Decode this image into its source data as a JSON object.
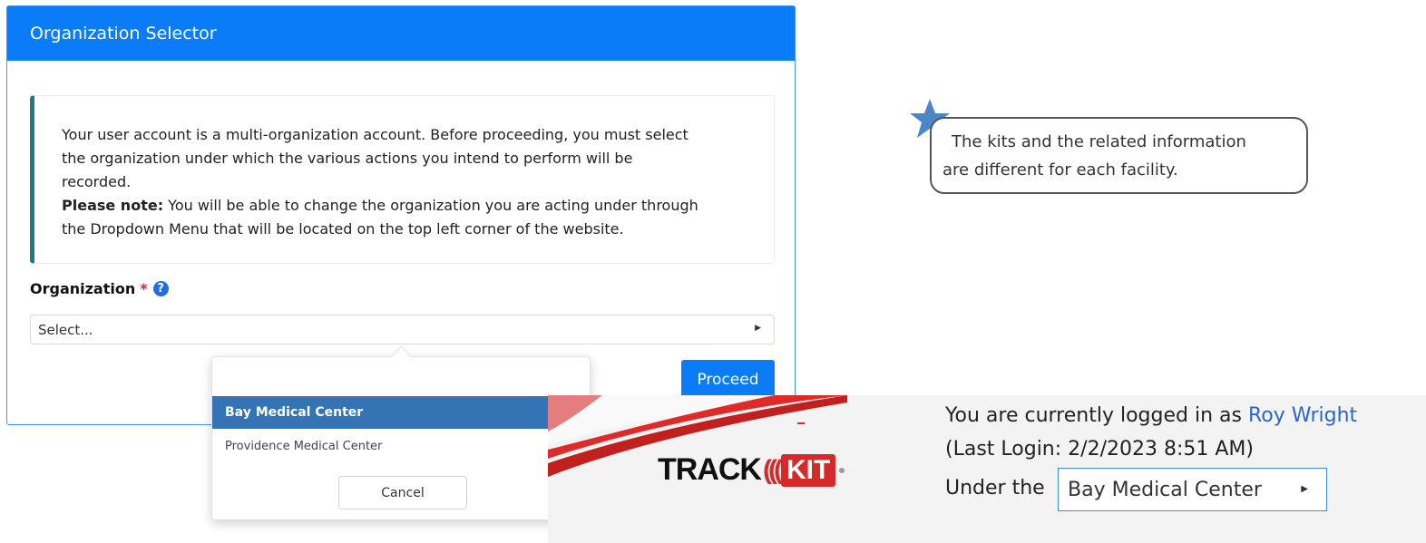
{
  "modal": {
    "title": "Organization Selector",
    "message_line1": "Your user account is a multi-organization account. Before proceeding, you must select",
    "message_line2": "the organization under which the various actions you intend to perform will be",
    "message_line3": "recorded.",
    "note_label": "Please note:",
    "note_line1_rest": " You will be able to change the organization you are acting under through",
    "note_line2": "the Dropdown Menu that will be located on the top left corner of the website.",
    "org_label": "Organization",
    "required_mark": "*",
    "help_icon_glyph": "?",
    "select_placeholder": "Select...",
    "proceed_label": "Proceed"
  },
  "dropdown": {
    "options": [
      "Bay Medical Center",
      "Providence Medical Center"
    ],
    "selected_index": 0,
    "cancel_label": "Cancel"
  },
  "note_bubble": {
    "line1": "The kits and the related information",
    "line2": "are different for each facility.",
    "icon": "star-icon",
    "icon_color": "#4a86c8"
  },
  "banner": {
    "logo_track": "TRACK",
    "logo_waves": "(((",
    "logo_kit": "KIT",
    "login_prefix": "You are currently logged in as ",
    "user_name": "Roy Wright",
    "last_login": "(Last Login: 2/2/2023 8:51 AM)",
    "under_the": "Under the",
    "current_org": "Bay Medical Center",
    "accent_color": "#d62a2a"
  },
  "colors": {
    "primary": "#0a7cf7",
    "selected_option": "#3474b4",
    "callout_border": "#1f7a86"
  }
}
